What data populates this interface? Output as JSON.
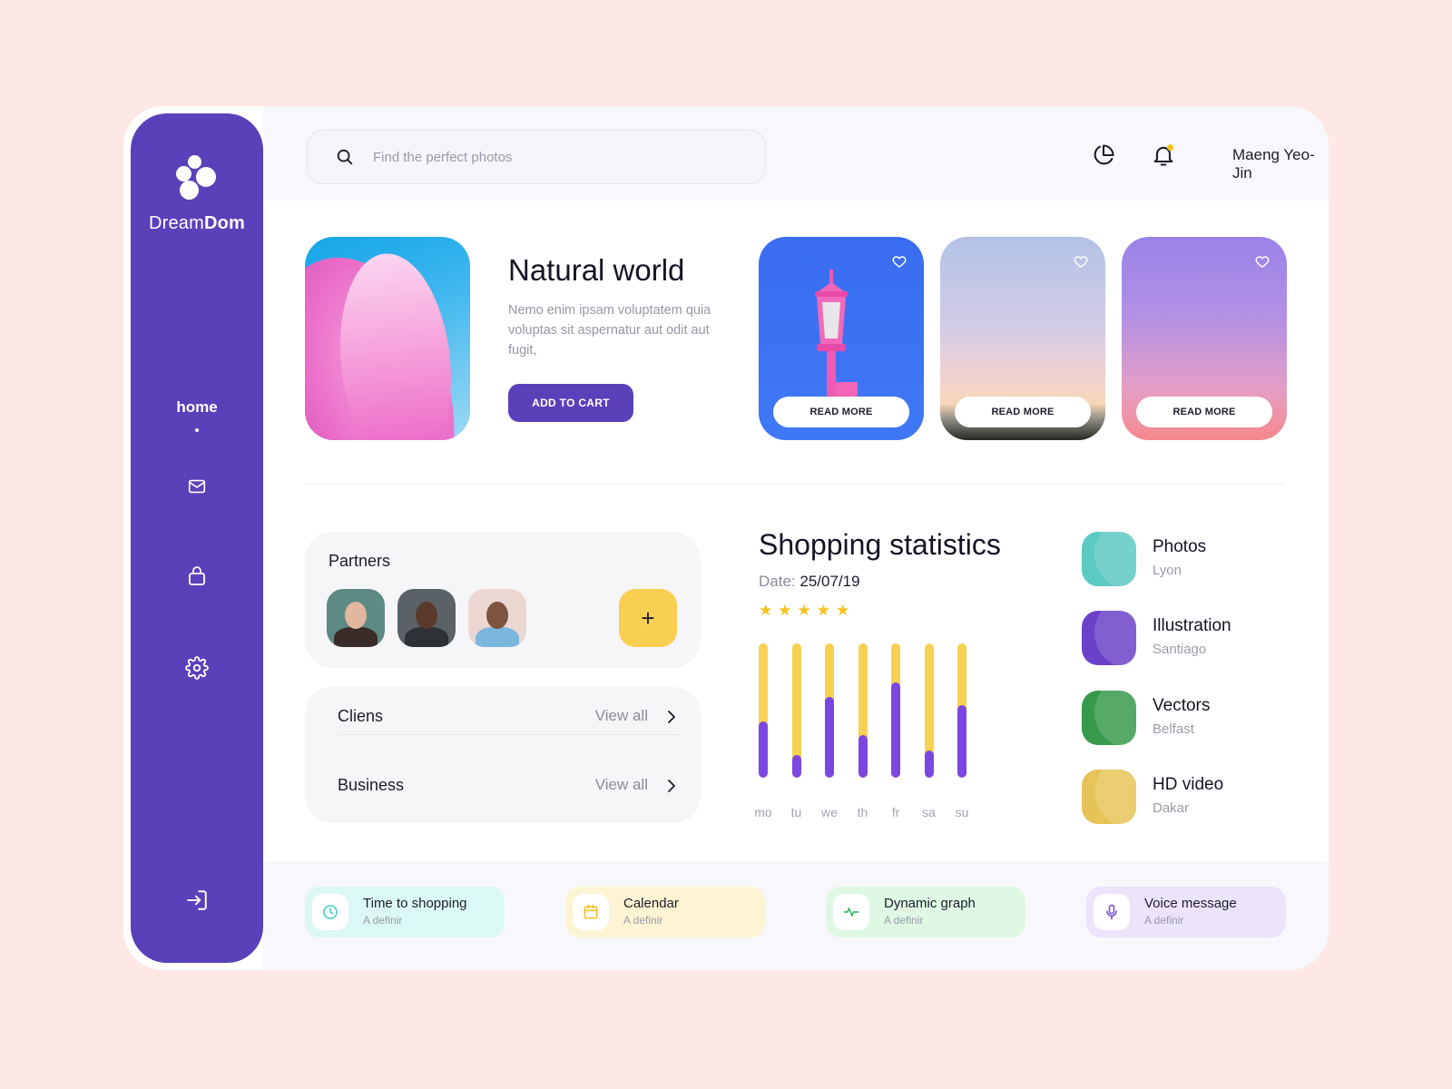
{
  "brand": {
    "name_light": "Dream",
    "name_bold": "Dom"
  },
  "sidebar": {
    "home_label": "home",
    "icons": [
      "mail-icon",
      "lock-icon",
      "settings-icon",
      "logout-icon"
    ]
  },
  "search": {
    "placeholder": "Find the perfect photos",
    "value": ""
  },
  "header": {
    "user_name": "Maeng Yeo-Jin",
    "icons": [
      "pie-chart-icon",
      "bell-icon"
    ]
  },
  "feature": {
    "title": "Natural world",
    "description": "Nemo enim ipsam voluptatem quia voluptas sit aspernatur aut odit aut fugit,",
    "button": "ADD TO CART"
  },
  "cards": [
    {
      "button": "READ MORE"
    },
    {
      "button": "READ MORE"
    },
    {
      "button": "READ MORE"
    }
  ],
  "partners": {
    "title": "Partners",
    "add_label": "+"
  },
  "links": [
    {
      "label": "Cliens",
      "action": "View all"
    },
    {
      "label": "Business",
      "action": "View all"
    }
  ],
  "stats": {
    "title": "Shopping statistics",
    "date_label": "Date:",
    "date_value": "25/07/19",
    "stars": "★★★★★",
    "rating": 5
  },
  "chart_data": {
    "type": "bar",
    "categories": [
      "mo",
      "tu",
      "we",
      "th",
      "fr",
      "sa",
      "su"
    ],
    "values": [
      0.42,
      0.17,
      0.6,
      0.32,
      0.71,
      0.2,
      0.54
    ],
    "colors": {
      "track": "#f7d151",
      "fill": "#7c47e0"
    }
  },
  "categories": [
    {
      "title": "Photos",
      "subtitle": "Lyon",
      "color": "#5cc9c3"
    },
    {
      "title": "Illustration",
      "subtitle": "Santiago",
      "color": "#6a41c8"
    },
    {
      "title": "Vectors",
      "subtitle": "Belfast",
      "color": "#37994a"
    },
    {
      "title": "HD video",
      "subtitle": "Dakar",
      "color": "#e6c356"
    }
  ],
  "chips": [
    {
      "title": "Time to shopping",
      "subtitle": "A definir",
      "icon": "clock-icon",
      "bg": "#dcf8f5",
      "accent": "#4fd1c5"
    },
    {
      "title": "Calendar",
      "subtitle": "A definir",
      "icon": "calendar-icon",
      "bg": "#fdf4d3",
      "accent": "#f2c230"
    },
    {
      "title": "Dynamic graph",
      "subtitle": "A definir",
      "icon": "activity-icon",
      "bg": "#def8e4",
      "accent": "#41b86a"
    },
    {
      "title": "Voice message",
      "subtitle": "A definir",
      "icon": "microphone-icon",
      "bg": "#ebe4fb",
      "accent": "#7d55d9"
    }
  ]
}
